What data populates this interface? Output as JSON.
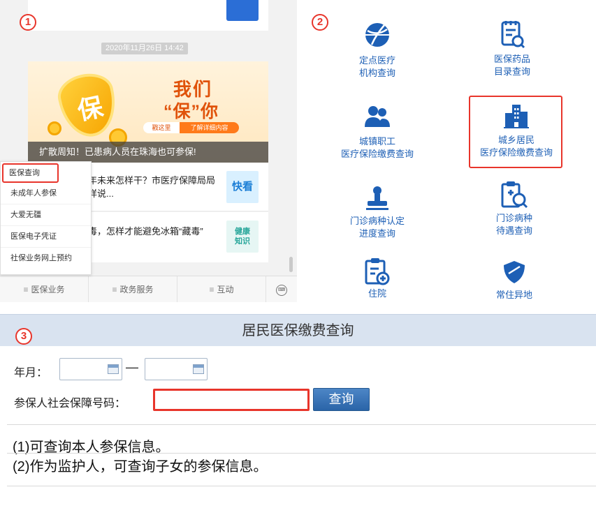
{
  "markers": {
    "one": "1",
    "two": "2",
    "three": "3"
  },
  "panel1": {
    "timestamp": "2020年11月26日 14:42",
    "banner": {
      "shield_char": "保",
      "headline_line1": "我们",
      "headline_line2": "“保”你",
      "pill_left": "戳这里",
      "pill_right": "了解详细内容",
      "caption": "扩散周知！已患病人员在珠海也可参保!"
    },
    "articles": [
      {
        "title_line1": "年未来怎样干？市医疗保障局局",
        "title_line2": "详说...",
        "thumb": "快看"
      },
      {
        "title_line1": "毒，怎样才能避免冰箱“藏毒”",
        "thumb_line1": "健康",
        "thumb_line2": "知识"
      }
    ],
    "menu": [
      "医保查询",
      "未成年人参保",
      "大爱无疆",
      "医保电子凭证",
      "社保业务网上预约"
    ],
    "tabs": [
      "医保业务",
      "政务服务",
      "互动"
    ],
    "keyboard_glyph": "⌨"
  },
  "panel2": {
    "items": [
      {
        "line1": "定点医疗",
        "line2": "机构查询"
      },
      {
        "line1": "医保药品",
        "line2": "目录查询"
      },
      {
        "line1": "城镇职工",
        "line2": "医疗保险缴费查询"
      },
      {
        "line1": "城乡居民",
        "line2": "医疗保险缴费查询"
      },
      {
        "line1": "门诊病种认定",
        "line2": "进度查询"
      },
      {
        "line1": "门诊病种",
        "line2": "待遇查询"
      },
      {
        "line1": "住院"
      },
      {
        "line1": "常住异地"
      }
    ]
  },
  "panel3": {
    "title": "居民医保缴费查询",
    "year_month_label": "年月：",
    "dash": "—",
    "id_label": "参保人社会保障号码：",
    "id_value": "",
    "query_button": "查询",
    "notes": [
      "(1)可查询本人参保信息。",
      "(2)作为监护人，可查询子女的参保信息。"
    ]
  },
  "colors": {
    "accent_red": "#e8352b",
    "link_blue": "#1d5fb5",
    "header_bg": "#d9e3f0",
    "button_blue": "#2a64a8"
  }
}
